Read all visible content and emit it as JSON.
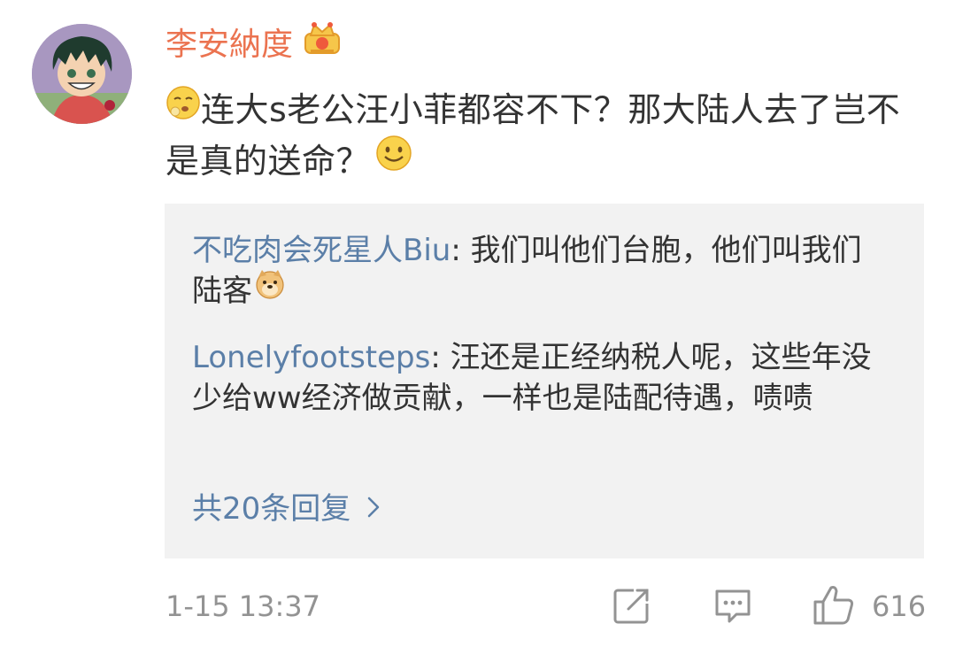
{
  "comment": {
    "username": "李安納度",
    "text_part1": "连大s老公汪小菲都容不下？那大陆人去了岂不是真的送命？",
    "time": "1-15 13:37",
    "like_count": "616"
  },
  "replies": [
    {
      "author": "不吃肉会死星人Biu",
      "text": "我们叫他们台胞，他们叫我们陆客"
    },
    {
      "author": "Lonelyfootsteps",
      "text": "汪还是正经纳税人呢，这些年没少给ww经济做贡献，一样也是陆配待遇，啧啧"
    }
  ],
  "more_replies_label": "共20条回复",
  "colors": {
    "username": "#eb7350",
    "link": "#5b7fa8",
    "reply_bg": "#f2f2f2",
    "meta": "#939393"
  },
  "icons": {
    "crown": "crown-badge-icon",
    "pre_emoji": "sleepy-face-emoji",
    "post_emoji": "smile-face-emoji",
    "reply_emoji": "doge-emoji",
    "share": "share-icon",
    "comment": "comment-icon",
    "like": "thumbs-up-icon",
    "chevron": "chevron-right-icon"
  }
}
